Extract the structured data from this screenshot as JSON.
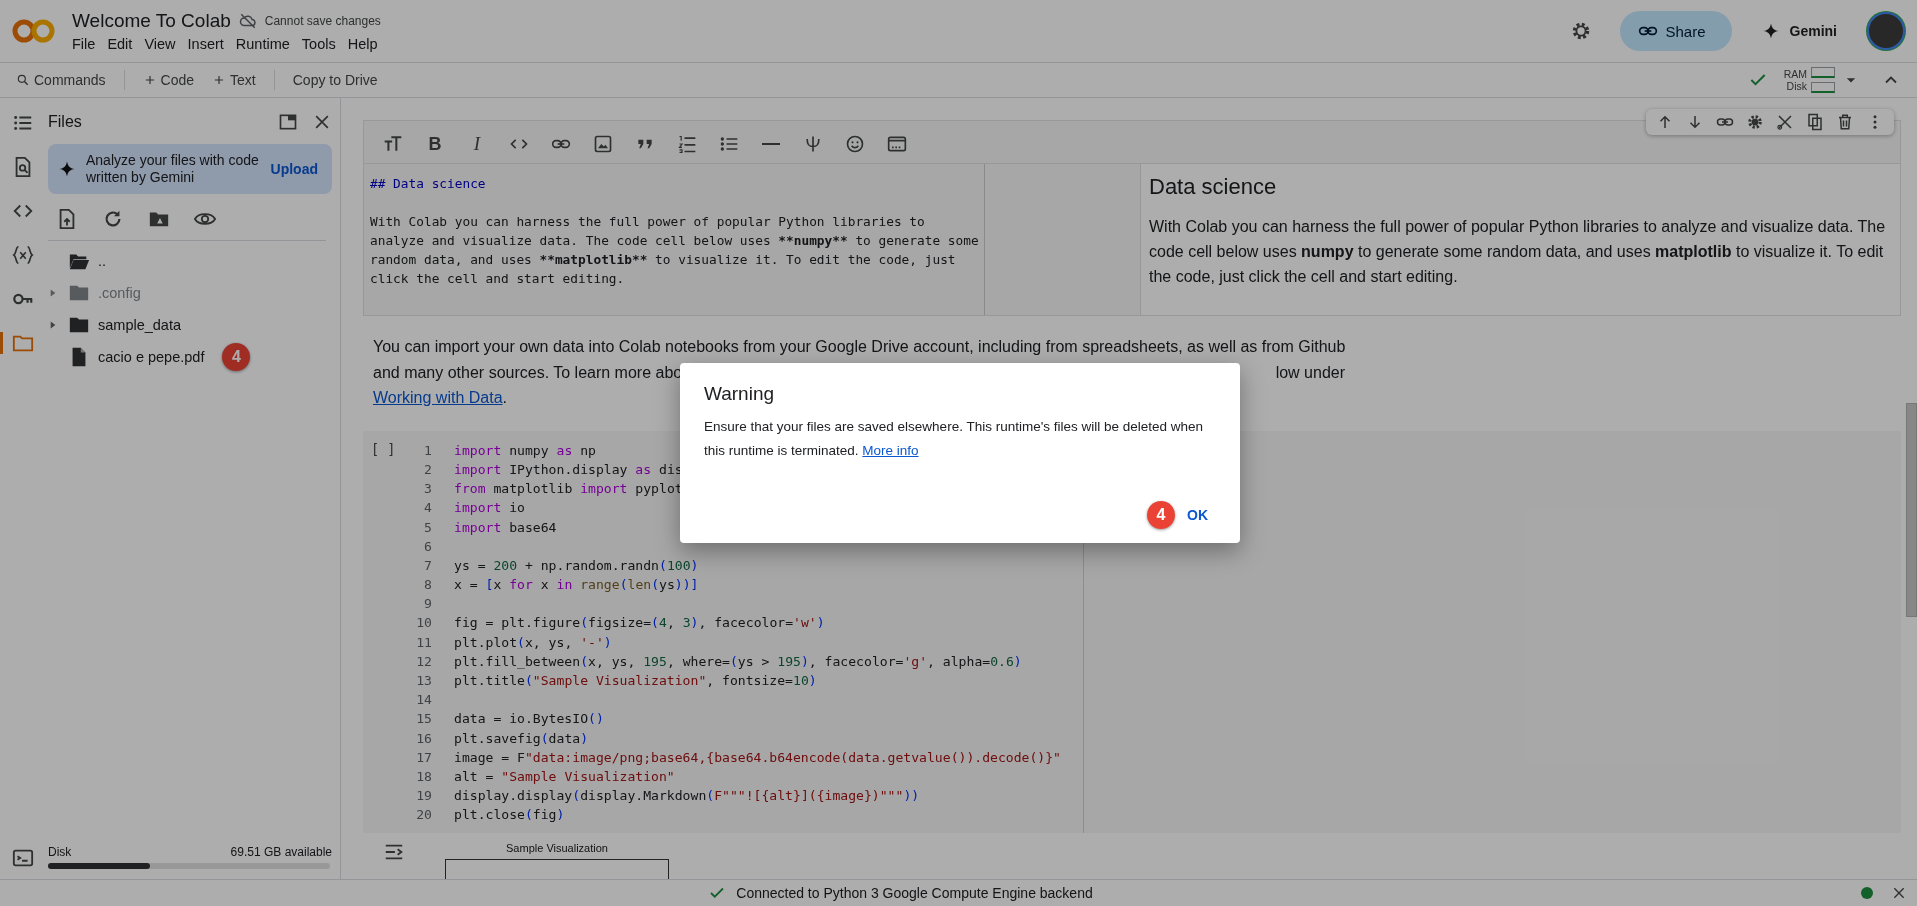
{
  "header": {
    "title": "Welcome To Colab",
    "save_status": "Cannot save changes",
    "menu": [
      "File",
      "Edit",
      "View",
      "Insert",
      "Runtime",
      "Tools",
      "Help"
    ],
    "share_label": "Share",
    "gemini_label": "Gemini"
  },
  "toolbar": {
    "commands": "Commands",
    "add_code": "Code",
    "add_text": "Text",
    "copy": "Copy to Drive",
    "ram_label": "RAM",
    "disk_label": "Disk"
  },
  "sidebar": {
    "items": [
      {
        "kind": "contents",
        "selected": false
      },
      {
        "kind": "find",
        "selected": false
      },
      {
        "kind": "snippets",
        "selected": false
      },
      {
        "kind": "variables",
        "selected": false
      },
      {
        "kind": "secrets",
        "selected": false
      },
      {
        "kind": "files",
        "selected": true
      }
    ]
  },
  "files_panel": {
    "title": "Files",
    "banner_text": "Analyze your files with code written by Gemini",
    "upload": "Upload",
    "tree": [
      {
        "kind": "parent",
        "name": "..",
        "dimmed": false
      },
      {
        "kind": "folder",
        "name": ".config",
        "expanded": false,
        "dimmed": true
      },
      {
        "kind": "folder",
        "name": "sample_data",
        "expanded": false,
        "dimmed": false
      },
      {
        "kind": "file",
        "name": "cacio e pepe.pdf",
        "badge": "4",
        "dimmed": false
      }
    ],
    "disk_label": "Disk",
    "disk": {
      "level": 0.36
    },
    "disk_available": "69.51 GB available"
  },
  "text_cell": {
    "toolbar": [
      {
        "kind": "text_size"
      },
      {
        "kind": "bold",
        "label": "B"
      },
      {
        "kind": "italic",
        "label": "I"
      },
      {
        "kind": "code"
      },
      {
        "kind": "link"
      },
      {
        "kind": "image"
      },
      {
        "kind": "quote"
      },
      {
        "kind": "numbered_list"
      },
      {
        "kind": "bulleted_list"
      },
      {
        "kind": "rule"
      },
      {
        "kind": "latex"
      },
      {
        "kind": "emoji"
      },
      {
        "kind": "window"
      }
    ],
    "source": {
      "heading": "## Data science",
      "lines": [
        [
          {
            "text": "With Colab you can harness the full power of popular Python libraries to",
            "bold": false
          }
        ],
        [
          {
            "text": "analyze and visualize data. The code cell below uses ",
            "bold": false
          },
          {
            "text": "**numpy**",
            "bold": true
          },
          {
            "text": " to generate some",
            "bold": false
          }
        ],
        [
          {
            "text": "random data, and uses ",
            "bold": false
          },
          {
            "text": "**matplotlib**",
            "bold": true
          },
          {
            "text": " to visualize it. To edit the code, just",
            "bold": false
          }
        ],
        [
          {
            "text": "click the cell and start editing.",
            "bold": false
          }
        ]
      ]
    },
    "preview": {
      "heading": "Data science",
      "body": "With Colab you can harness the full power of popular Python libraries to analyze and visualize data. The code cell below uses **numpy** to generate some random data, and uses **matplotlib** to visualize it. To edit the code, just click the cell and start editing."
    }
  },
  "cell_actions": [
    {
      "kind": "up"
    },
    {
      "kind": "down"
    },
    {
      "kind": "link"
    },
    {
      "kind": "settings"
    },
    {
      "kind": "cut"
    },
    {
      "kind": "mirror"
    },
    {
      "kind": "delete"
    },
    {
      "kind": "more"
    }
  ],
  "paragraph": {
    "line_1": "You can import your own data into Colab notebooks from your Google Drive account, including from spreadsheets, as well as from Github",
    "line_2_start": "and many other sources. To learn more abo",
    "line_2_end": "low under",
    "link": "Working with Data",
    "link_tail": "."
  },
  "code_cell": {
    "prompt": "[ ]",
    "lines": [
      {
        "number": "1",
        "tokens": [
          {
            "kind": "kw",
            "text": "import"
          },
          {
            "kind": "plain",
            "text": " numpy "
          },
          {
            "kind": "kw",
            "text": "as"
          },
          {
            "kind": "plain",
            "text": " np"
          }
        ]
      },
      {
        "number": "2",
        "tokens": [
          {
            "kind": "kw",
            "text": "import"
          },
          {
            "kind": "plain",
            "text": " IPython.display "
          },
          {
            "kind": "kw",
            "text": "as"
          },
          {
            "kind": "plain",
            "text": " dis"
          }
        ]
      },
      {
        "number": "3",
        "tokens": [
          {
            "kind": "kw",
            "text": "from"
          },
          {
            "kind": "plain",
            "text": " matplotlib "
          },
          {
            "kind": "kw",
            "text": "import"
          },
          {
            "kind": "plain",
            "text": " pyplot"
          }
        ]
      },
      {
        "number": "4",
        "tokens": [
          {
            "kind": "kw",
            "text": "import"
          },
          {
            "kind": "plain",
            "text": " io"
          }
        ]
      },
      {
        "number": "5",
        "tokens": [
          {
            "kind": "kw",
            "text": "import"
          },
          {
            "kind": "plain",
            "text": " base64"
          }
        ]
      },
      {
        "number": "6"
      },
      {
        "number": "7",
        "tokens": [
          {
            "kind": "plain",
            "text": "ys = "
          },
          {
            "kind": "num",
            "text": "200"
          },
          {
            "kind": "plain",
            "text": " + np.random.randn"
          },
          {
            "kind": "br",
            "text": "("
          },
          {
            "kind": "num",
            "text": "100"
          },
          {
            "kind": "br",
            "text": ")"
          }
        ]
      },
      {
        "number": "8",
        "tokens": [
          {
            "kind": "plain",
            "text": "x = "
          },
          {
            "kind": "br",
            "text": "["
          },
          {
            "kind": "plain",
            "text": "x "
          },
          {
            "kind": "kw",
            "text": "for"
          },
          {
            "kind": "plain",
            "text": " x "
          },
          {
            "kind": "kw",
            "text": "in"
          },
          {
            "kind": "fn",
            "text": " range"
          },
          {
            "kind": "br",
            "text": "("
          },
          {
            "kind": "fn",
            "text": "len"
          },
          {
            "kind": "br",
            "text": "("
          },
          {
            "kind": "plain",
            "text": "ys"
          },
          {
            "kind": "br",
            "text": "))]"
          }
        ]
      },
      {
        "number": "9"
      },
      {
        "number": "10",
        "tokens": [
          {
            "kind": "plain",
            "text": "fig = plt.figure"
          },
          {
            "kind": "br",
            "text": "("
          },
          {
            "kind": "plain",
            "text": "figsize="
          },
          {
            "kind": "br",
            "text": "("
          },
          {
            "kind": "num",
            "text": "4"
          },
          {
            "kind": "plain",
            "text": ", "
          },
          {
            "kind": "num",
            "text": "3"
          },
          {
            "kind": "br",
            "text": ")"
          },
          {
            "kind": "plain",
            "text": ", facecolor="
          },
          {
            "kind": "str",
            "text": "'w'"
          },
          {
            "kind": "br",
            "text": ")"
          }
        ]
      },
      {
        "number": "11",
        "tokens": [
          {
            "kind": "plain",
            "text": "plt.plot"
          },
          {
            "kind": "br",
            "text": "("
          },
          {
            "kind": "plain",
            "text": "x, ys, "
          },
          {
            "kind": "str",
            "text": "'-'"
          },
          {
            "kind": "br",
            "text": ")"
          }
        ]
      },
      {
        "number": "12",
        "tokens": [
          {
            "kind": "plain",
            "text": "plt.fill_between"
          },
          {
            "kind": "br",
            "text": "("
          },
          {
            "kind": "plain",
            "text": "x, ys, "
          },
          {
            "kind": "num",
            "text": "195"
          },
          {
            "kind": "plain",
            "text": ", where="
          },
          {
            "kind": "br",
            "text": "("
          },
          {
            "kind": "plain",
            "text": "ys > "
          },
          {
            "kind": "num",
            "text": "195"
          },
          {
            "kind": "br",
            "text": ")"
          },
          {
            "kind": "plain",
            "text": ", facecolor="
          },
          {
            "kind": "str",
            "text": "'g'"
          },
          {
            "kind": "plain",
            "text": ", alpha="
          },
          {
            "kind": "num",
            "text": "0.6"
          },
          {
            "kind": "br",
            "text": ")"
          }
        ]
      },
      {
        "number": "13",
        "tokens": [
          {
            "kind": "plain",
            "text": "plt.title"
          },
          {
            "kind": "br",
            "text": "("
          },
          {
            "kind": "str",
            "text": "\"Sample Visualization\""
          },
          {
            "kind": "plain",
            "text": ", fontsize="
          },
          {
            "kind": "num",
            "text": "10"
          },
          {
            "kind": "br",
            "text": ")"
          }
        ]
      },
      {
        "number": "14"
      },
      {
        "number": "15",
        "tokens": [
          {
            "kind": "plain",
            "text": "data = io.BytesIO"
          },
          {
            "kind": "br",
            "text": "()"
          }
        ]
      },
      {
        "number": "16",
        "tokens": [
          {
            "kind": "plain",
            "text": "plt.savefig"
          },
          {
            "kind": "br",
            "text": "("
          },
          {
            "kind": "plain",
            "text": "data"
          },
          {
            "kind": "br",
            "text": ")"
          }
        ]
      },
      {
        "number": "17",
        "tokens": [
          {
            "kind": "plain",
            "text": "image = F"
          },
          {
            "kind": "str",
            "text": "\"data:image/png;base64,{base64.b64encode(data.getvalue()).decode()}\""
          }
        ]
      },
      {
        "number": "18",
        "tokens": [
          {
            "kind": "plain",
            "text": "alt = "
          },
          {
            "kind": "str",
            "text": "\"Sample Visualization\""
          }
        ]
      },
      {
        "number": "19",
        "tokens": [
          {
            "kind": "plain",
            "text": "display.display"
          },
          {
            "kind": "br",
            "text": "("
          },
          {
            "kind": "plain",
            "text": "display.Markdown"
          },
          {
            "kind": "br",
            "text": "("
          },
          {
            "kind": "str",
            "text": "F\"\"\"![{alt}]({image})\"\"\""
          },
          {
            "kind": "br",
            "text": "))"
          }
        ]
      },
      {
        "number": "20",
        "tokens": [
          {
            "kind": "plain",
            "text": "plt.close"
          },
          {
            "kind": "br",
            "text": "("
          },
          {
            "kind": "plain",
            "text": "fig"
          },
          {
            "kind": "br",
            "text": ")"
          }
        ]
      }
    ]
  },
  "output": {
    "chart_title": "Sample Visualization"
  },
  "dialog": {
    "title": "Warning",
    "message": "Ensure that your files are saved elsewhere. This runtime's files will be deleted when this runtime is terminated.",
    "link": "More info",
    "badge": "4",
    "button": "OK"
  },
  "status_bar": {
    "message": "Connected to Python 3 Google Compute Engine backend"
  }
}
